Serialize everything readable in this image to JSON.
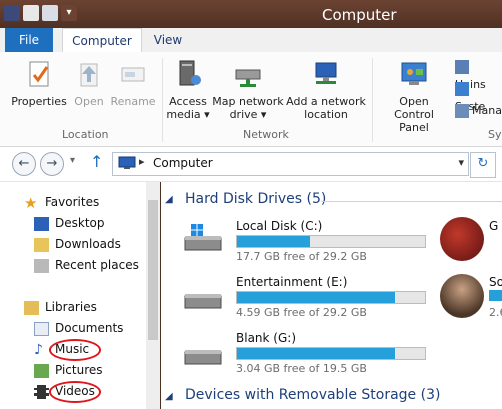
{
  "window": {
    "title": "Computer"
  },
  "tabs": {
    "file": "File",
    "computer": "Computer",
    "view": "View"
  },
  "ribbon": {
    "location": {
      "properties": "Properties",
      "open": "Open",
      "rename": "Rename",
      "label": "Location"
    },
    "network": {
      "access_media": [
        "Access",
        "media ▾"
      ],
      "map_drive": [
        "Map network",
        "drive ▾"
      ],
      "add_location": [
        "Add a network",
        "location"
      ],
      "label": "Network"
    },
    "system": {
      "control_panel": [
        "Open Control",
        "Panel"
      ],
      "uninstall": "Unins",
      "system_props": "Syste",
      "manage": "Mana",
      "label": "Sy"
    }
  },
  "address": {
    "path": "Computer",
    "separator": "▸"
  },
  "nav": {
    "favorites": "Favorites",
    "desktop": "Desktop",
    "downloads": "Downloads",
    "recent": "Recent places",
    "libraries": "Libraries",
    "documents": "Documents",
    "music": "Music",
    "pictures": "Pictures",
    "videos": "Videos"
  },
  "content": {
    "hard_disks_title": "Hard Disk Drives (5)",
    "removable_title": "Devices with Removable Storage (3)",
    "drives": [
      {
        "name": "Local Disk (C:)",
        "free": "17.7 GB free of 29.2 GB",
        "used_fraction": 0.39
      },
      {
        "name": "Entertainment (E:)",
        "free": "4.59 GB free of 29.2 GB",
        "used_fraction": 0.84
      },
      {
        "name": "Blank (G:)",
        "free": "3.04 GB free of 19.5 GB",
        "used_fraction": 0.84
      }
    ],
    "right_col": {
      "g_label": "G",
      "s_label": "So",
      "free_partial": "2.6"
    }
  },
  "colors": {
    "accent": "#26a0da",
    "file_tab": "#1f6fbf",
    "annotation": "#e0151a"
  }
}
